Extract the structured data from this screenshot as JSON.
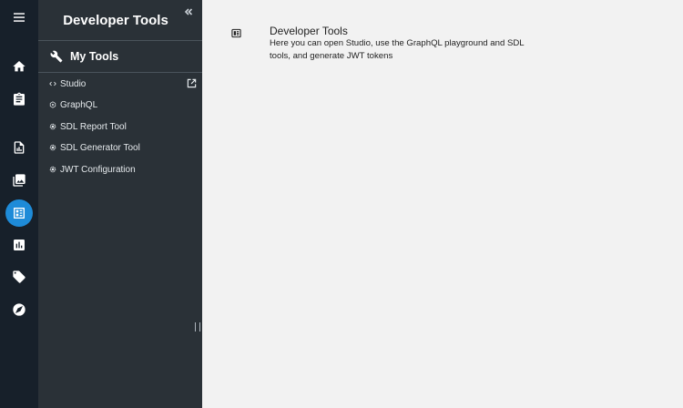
{
  "rail": {
    "items": [
      {
        "icon": "menu-icon"
      },
      {
        "icon": "home-icon"
      },
      {
        "icon": "clipboard-icon"
      },
      {
        "icon": "document-chart-icon"
      },
      {
        "icon": "photo-library-icon"
      },
      {
        "icon": "developer-board-icon",
        "active": true
      },
      {
        "icon": "bar-chart-icon"
      },
      {
        "icon": "tag-icon"
      },
      {
        "icon": "compass-icon"
      }
    ],
    "accent": "#1e8bd8"
  },
  "sidebar": {
    "title": "Developer Tools",
    "section": "My Tools",
    "items": [
      {
        "label": "Studio",
        "icon": "code-icon",
        "external": true
      },
      {
        "label": "GraphQL",
        "icon": "graphql-icon"
      },
      {
        "label": "SDL Report Tool",
        "icon": "gear-icon"
      },
      {
        "label": "SDL Generator Tool",
        "icon": "gear-icon"
      },
      {
        "label": "JWT Configuration",
        "icon": "gear-icon"
      }
    ]
  },
  "main": {
    "title": "Developer Tools",
    "description": "Here you can open Studio, use the GraphQL playground and SDL tools, and generate JWT tokens"
  }
}
